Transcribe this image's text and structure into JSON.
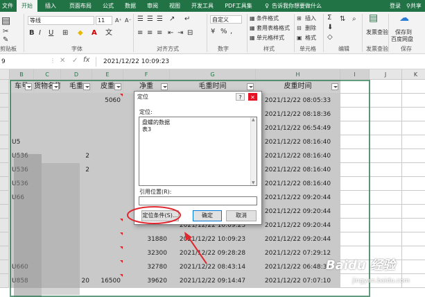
{
  "tabs": [
    "文件",
    "开始",
    "插入",
    "页面布局",
    "公式",
    "数据",
    "审阅",
    "视图",
    "开发工具",
    "PDF工具集"
  ],
  "tell_me": "告诉我你想要做什么",
  "login": "登录",
  "share": "共享",
  "ribbon": {
    "paste_group": "剪贴板",
    "font_name": "等线",
    "font_size": "11",
    "font_group": "字体",
    "align_group": "对齐方式",
    "number_format": "自定义",
    "number_group": "数字",
    "conditional_format": "条件格式",
    "table_format": "套用表格格式",
    "cell_style": "单元格样式",
    "style_group": "样式",
    "insert": "插入",
    "delete": "删除",
    "format": "格式",
    "cells_group": "单元格",
    "edit_group": "编辑",
    "invoice_check": "发票查验",
    "invoice_group": "发票查验",
    "save_to_baidu_1": "保存到",
    "save_to_baidu_2": "百度网盘",
    "save_group": "保存"
  },
  "formula_bar": {
    "namebox": "9",
    "value": "2021/12/22  10:09:23"
  },
  "columns": [
    "B",
    "C",
    "D",
    "E",
    "F",
    "G",
    "H",
    "I",
    "J",
    "K"
  ],
  "headers": {
    "B": "车号",
    "C": "货物名称",
    "D": "毛重",
    "E": "皮重",
    "F": "净重",
    "G": "毛重时间",
    "H": "皮重时间"
  },
  "rows": [
    {
      "B": "",
      "C": "",
      "D": "",
      "E": "5060",
      "F": "",
      "G": "",
      "H": "2021/12/22 08:05:33"
    },
    {
      "B": "",
      "C": "",
      "D": "",
      "E": "",
      "F": "",
      "G": "",
      "H": "2021/12/22 08:18:36"
    },
    {
      "B": "",
      "C": "",
      "D": "",
      "E": "",
      "F": "",
      "G": "",
      "H": "2021/12/22 06:54:49"
    },
    {
      "B": "U5",
      "C": "",
      "D": "",
      "E": "",
      "F": "",
      "G": "",
      "H": "2021/12/22 08:16:40"
    },
    {
      "B": "U536",
      "C": "",
      "D": "2",
      "E": "",
      "F": "",
      "G": "",
      "H": "2021/12/22 08:16:40"
    },
    {
      "B": "U536",
      "C": "",
      "D": "2",
      "E": "",
      "F": "",
      "G": "",
      "H": "2021/12/22 08:16:40"
    },
    {
      "B": "U536",
      "C": "",
      "D": "",
      "E": "",
      "F": "",
      "G": "",
      "H": "2021/12/22 08:16:40"
    },
    {
      "B": "U66",
      "C": "",
      "D": "",
      "E": "",
      "F": "",
      "G": "",
      "H": "2021/12/22 09:20:44"
    },
    {
      "B": "",
      "C": "",
      "D": "",
      "E": "",
      "F": "",
      "G": "",
      "H": "2021/12/22 09:20:44"
    },
    {
      "B": "",
      "C": "",
      "D": "",
      "E": "",
      "F": "",
      "G": "2021/12/22 10:09:23",
      "H": "2021/12/22 09:20:44"
    },
    {
      "B": "",
      "C": "",
      "D": "",
      "E": "",
      "F": "31880",
      "G": "2021/12/22 10:09:23",
      "H": "2021/12/22 09:20:44"
    },
    {
      "B": "",
      "C": "",
      "D": "",
      "E": "",
      "F": "32300",
      "G": "2021/12/22 09:28:28",
      "H": "2021/12/22 07:29:12"
    },
    {
      "B": "U660",
      "C": "",
      "D": "",
      "E": "",
      "F": "32780",
      "G": "2021/12/22 08:43:14",
      "H": "2021/12/22 06:48:34"
    },
    {
      "B": "U858",
      "C": "",
      "D": "20",
      "E": "16500",
      "F": "39620",
      "G": "2021/12/22 09:14:47",
      "H": "2021/12/22 07:07:10"
    }
  ],
  "dialog": {
    "title": "定位",
    "help": "?",
    "close": "✕",
    "goto_label": "定位:",
    "list": [
      "盘螺的数据",
      "表3"
    ],
    "ref_label": "引用位置(R):",
    "ref_value": "",
    "special_button": "定位条件(S)...",
    "ok_button": "确定",
    "cancel_button": "取消"
  },
  "watermark": {
    "line1": "Baidu 经验",
    "line2": "jingyan.baidu.com"
  },
  "colors": {
    "excel_green": "#217346",
    "highlight_red": "#e0272f",
    "selection_gray": "#c9c9c9",
    "blur_gray": "#8f8f8f"
  }
}
